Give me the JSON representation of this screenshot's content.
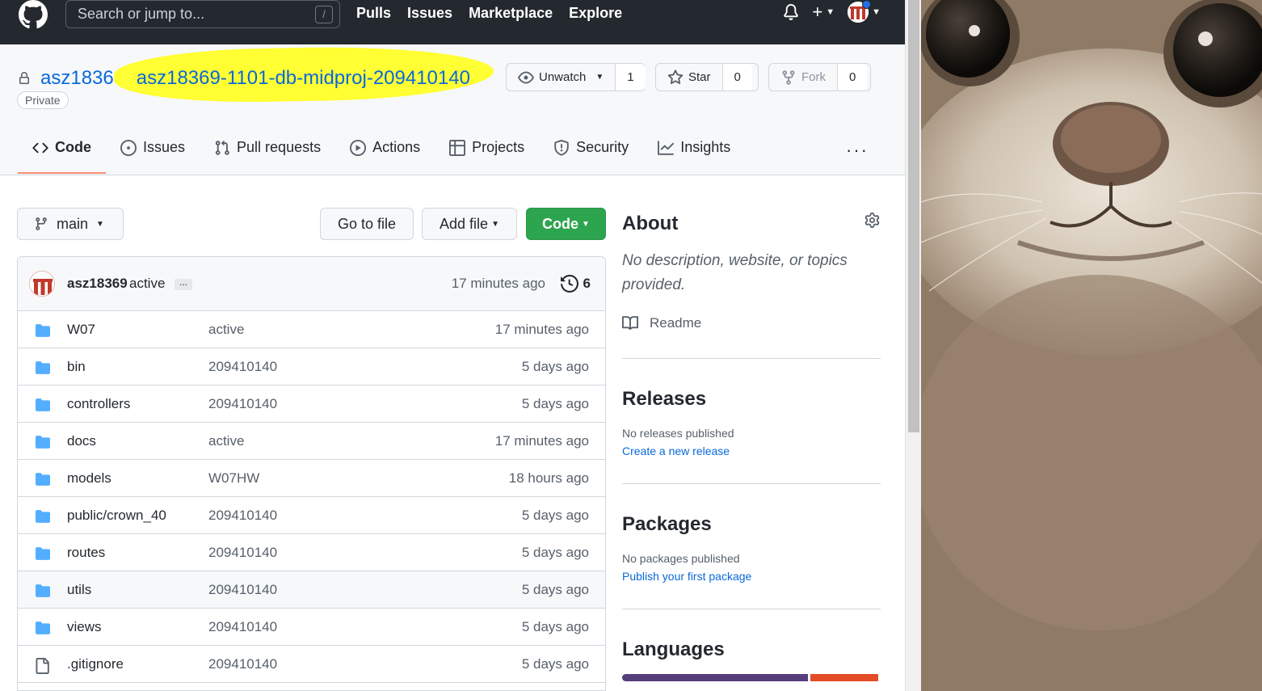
{
  "header": {
    "search_placeholder": "Search or jump to...",
    "search_shortcut": "/",
    "nav": [
      "Pulls",
      "Issues",
      "Marketplace",
      "Explore"
    ],
    "plus": "+"
  },
  "repo": {
    "owner": "asz18369",
    "separator": "/",
    "name": "asz18369-1101-db-midproj-209410140",
    "visibility": "Private",
    "highlight_color": "#ffff33",
    "unwatch_label": "Unwatch",
    "watch_count": "1",
    "star_label": "Star",
    "star_count": "0",
    "fork_label": "Fork",
    "fork_count": "0"
  },
  "tabs": [
    {
      "label": "Code",
      "icon": "code-icon",
      "active": true
    },
    {
      "label": "Issues",
      "icon": "issue-opened-icon"
    },
    {
      "label": "Pull requests",
      "icon": "git-pull-request-icon"
    },
    {
      "label": "Actions",
      "icon": "play-icon"
    },
    {
      "label": "Projects",
      "icon": "table-icon"
    },
    {
      "label": "Security",
      "icon": "shield-icon"
    },
    {
      "label": "Insights",
      "icon": "graph-icon"
    }
  ],
  "tabs_more": "···",
  "toolbar": {
    "branch": "main",
    "go_to_file": "Go to file",
    "add_file": "Add file",
    "code": "Code"
  },
  "latest_commit": {
    "author": "asz18369",
    "message": "active",
    "ellipsis": "...",
    "time": "17 minutes ago",
    "commit_count": "6"
  },
  "files": [
    {
      "name": "W07",
      "type": "folder",
      "message": "active",
      "time": "17 minutes ago"
    },
    {
      "name": "bin",
      "type": "folder",
      "message": "209410140",
      "time": "5 days ago"
    },
    {
      "name": "controllers",
      "type": "folder",
      "message": "209410140",
      "time": "5 days ago"
    },
    {
      "name": "docs",
      "type": "folder",
      "message": "active",
      "time": "17 minutes ago"
    },
    {
      "name": "models",
      "type": "folder",
      "message": "W07HW",
      "time": "18 hours ago"
    },
    {
      "name": "public/crown_40",
      "type": "folder",
      "message": "209410140",
      "time": "5 days ago"
    },
    {
      "name": "routes",
      "type": "folder",
      "message": "209410140",
      "time": "5 days ago"
    },
    {
      "name": "utils",
      "type": "folder",
      "message": "209410140",
      "time": "5 days ago"
    },
    {
      "name": "views",
      "type": "folder",
      "message": "209410140",
      "time": "5 days ago"
    },
    {
      "name": ".gitignore",
      "type": "file",
      "message": "209410140",
      "time": "5 days ago"
    }
  ],
  "sidebar": {
    "about_title": "About",
    "about_desc": "No description, website, or topics provided.",
    "readme": "Readme",
    "releases_title": "Releases",
    "releases_none": "No releases published",
    "releases_link": "Create a new release",
    "packages_title": "Packages",
    "packages_none": "No packages published",
    "packages_link": "Publish your first package",
    "languages_title": "Languages",
    "languages": [
      {
        "color": "#563d7c",
        "share": 0.72
      },
      {
        "color": "#e34c26",
        "share": 0.26
      }
    ]
  }
}
